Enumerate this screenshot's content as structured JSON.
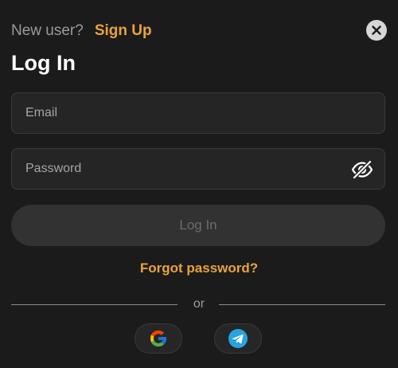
{
  "header": {
    "prompt_text": "New user?",
    "signup_label": "Sign Up",
    "title": "Log In"
  },
  "form": {
    "email_placeholder": "Email",
    "email_value": "",
    "password_placeholder": "Password",
    "password_value": "",
    "submit_label": "Log In",
    "forgot_label": "Forgot password?"
  },
  "divider": {
    "label": "or"
  },
  "social": {
    "providers": [
      "google-icon",
      "telegram-icon"
    ]
  },
  "colors": {
    "accent": "#e8a33c",
    "background": "#1c1b1b",
    "field_bg": "#252525",
    "button_disabled_bg": "#333232",
    "telegram_blue": "#2aa3e0"
  }
}
